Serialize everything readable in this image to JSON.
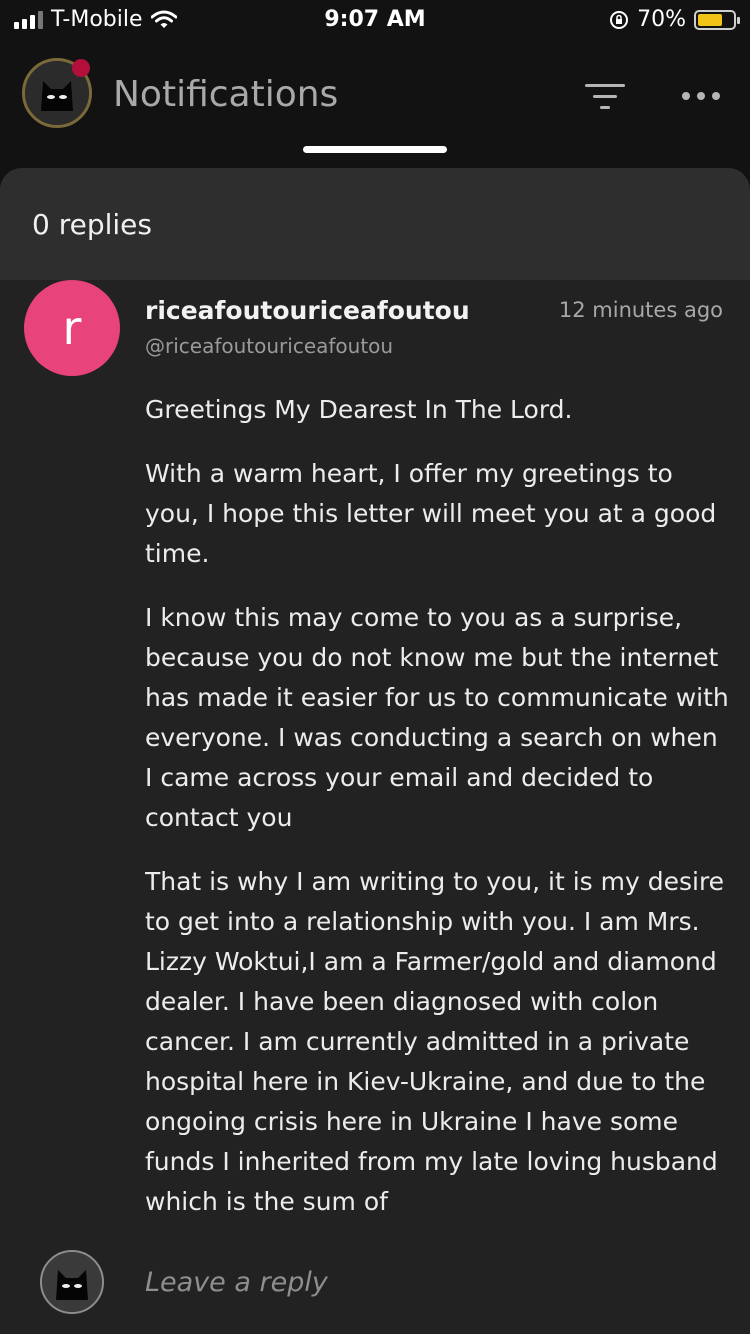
{
  "status_bar": {
    "carrier": "T-Mobile",
    "time": "9:07 AM",
    "battery": "70%",
    "battery_level": 0.7,
    "icons": [
      "signal-icon",
      "wifi-icon",
      "orientation-lock-icon",
      "battery-icon"
    ]
  },
  "header": {
    "title": "Notifications",
    "icons": [
      "avatar",
      "filter-icon",
      "more-icon"
    ]
  },
  "thread": {
    "replies_label": "0 replies"
  },
  "post": {
    "avatar_letter": "r",
    "avatar_color": "#e8437a",
    "username": "riceafoutouriceafoutou",
    "handle": "@riceafoutouriceafoutou",
    "time_ago": "12 minutes ago",
    "paragraphs": [
      "Greetings My Dearest In The Lord.",
      "With a warm heart, I offer my greetings to you, I hope this letter will meet you at a good time.",
      "I know this may come to you as a surprise, because you do not know me but the internet has made it easier for us to communicate with everyone. I was conducting a search on  when I came across your email and decided to contact you",
      "That is why I am writing to you, it is my desire to get into a relationship with you. I am Mrs. Lizzy Woktui,I am a Farmer/gold and diamond dealer. I have been diagnosed with colon cancer. I am currently admitted in a private hospital here in Kiev-Ukraine, and due to the ongoing crisis here in Ukraine I have some funds I inherited from my late loving husband which is the sum of"
    ]
  },
  "reply": {
    "placeholder": "Leave a reply"
  }
}
